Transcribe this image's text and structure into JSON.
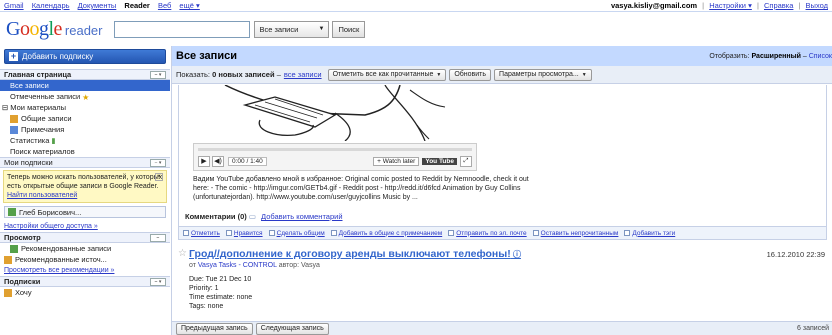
{
  "topbar": {
    "links": [
      "Gmail",
      "Календарь",
      "Документы",
      "Reader",
      "Веб",
      "ещё ▾"
    ],
    "active_link": "Reader",
    "email": "vasya.kisliy@gmail.com",
    "settings": "Настройки ▾",
    "help": "Справка",
    "exit": "Выход"
  },
  "header": {
    "logo_reader": "reader",
    "search_value": "",
    "scope": "Все записи",
    "search_button": "Поиск"
  },
  "nav": {
    "add_subscription": "Добавить подписку",
    "home": "Главная страница",
    "all_items": "Все записи",
    "starred": "Отмеченные записи",
    "my_materials": "Мои материалы",
    "shared": "Общие записи",
    "notes": "Примечания",
    "stats": "Статистика",
    "search_materials": "Поиск материалов",
    "my_subscriptions": "Мои подписки",
    "tip_text": "Теперь можно искать пользователей, у которых есть открытые общие записи в Google Reader.",
    "tip_link": "Найти пользователей",
    "person": "Глеб Борисович...",
    "share_settings": "Настройки общего доступа »",
    "browse_header": "Просмотр",
    "recommended_items": "Рекомендованные записи",
    "recommended_sources": "Рекомендованные источ...",
    "view_all_recs": "Просмотреть все рекомендации »",
    "subscriptions_header": "Подписки",
    "folder": "Хочу"
  },
  "main": {
    "title": "Все записи",
    "sort_label": "Отобразить:",
    "sort_value": "Расширенный",
    "sort_sep": "–",
    "sort_link": "Список",
    "filter_label": "Показать:",
    "new_items": "0 новых записей",
    "filter_sep": "–",
    "all_items_link": "все записи",
    "mark_all_read": "Отметить все как прочитанные",
    "refresh": "Обновить",
    "view_settings": "Параметры просмотра..."
  },
  "entry1": {
    "player_time": "0:00 / 1:40",
    "watch_later": "Watch later",
    "yt": "You Tube",
    "description_line1": "Вадим YouTube добавлено мной в избранное: Original comic posted to Reddit by Nemnoodle, check it out",
    "description_line2": "here: - The comic - http://imgur.com/GETb4.gif - Reddit post - http://redd.it/d6fcd Animation by Guy Collins",
    "description_line3": "(unfortunatejordan). http://www.youtube.com/user/guyjcollins Music by ...",
    "comments_label": "Комментарии (0)",
    "add_comment": "Добавить комментарий",
    "actions": [
      "Отметить",
      "Нравится",
      "Сделать общим",
      "Добавить в общие с примечанием",
      "Отправить по эл. почте",
      "Оставить непрочитанным",
      "Добавить тэги"
    ]
  },
  "entry2": {
    "title": "Грод//дополнение к договору аренды выключают телефоны!",
    "date": "16.12.2010 22:39",
    "source_prefix": "от",
    "source_link": "Vasya Tasks - CONTROL",
    "author_label": "автор: Vasya",
    "body_line1": "Due: Tue 21 Dec 10",
    "body_line2": "Priority: 1",
    "body_line3": "Time estimate: none",
    "body_line4": "Tags: none"
  },
  "bottom": {
    "prev": "Предыдущая запись",
    "next": "Следующая запись",
    "count": "6 записей"
  }
}
